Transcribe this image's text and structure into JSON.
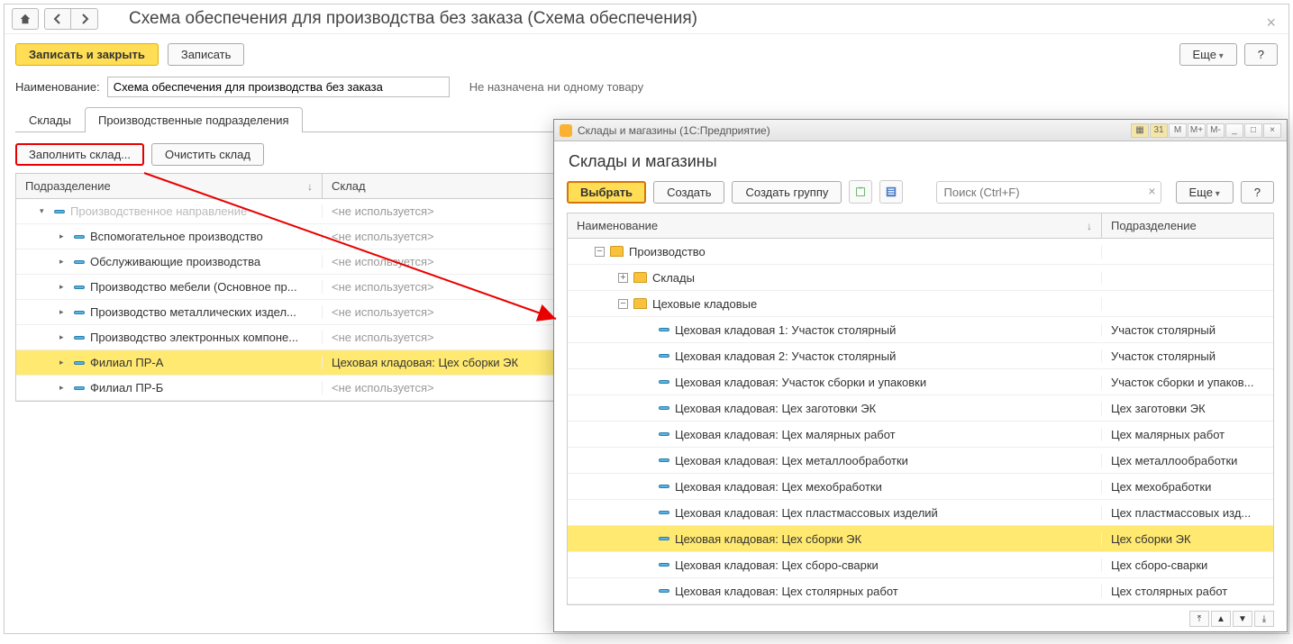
{
  "header": {
    "title": "Схема обеспечения для производства без заказа (Схема обеспечения)"
  },
  "toolbar": {
    "save_close": "Записать и закрыть",
    "save": "Записать",
    "more": "Еще",
    "help": "?"
  },
  "fields": {
    "name_label": "Наименование:",
    "name_value": "Схема обеспечения для производства без заказа",
    "status": "Не назначена ни одному товару"
  },
  "tabs": {
    "warehouses": "Склады",
    "departments": "Производственные подразделения"
  },
  "subtoolbar": {
    "fill": "Заполнить склад...",
    "clear": "Очистить склад"
  },
  "grid": {
    "col_dept": "Подразделение",
    "col_wh": "Склад",
    "not_used": "<не используется>",
    "rows": [
      {
        "indent": 0,
        "exp": "▾",
        "name": "Производственное направление",
        "wh": "<не используется>",
        "muted": true
      },
      {
        "indent": 1,
        "exp": "▸",
        "name": "Вспомогательное производство",
        "wh": "<не используется>",
        "muted": false
      },
      {
        "indent": 1,
        "exp": "▸",
        "name": "Обслуживающие производства",
        "wh": "<не используется>",
        "muted": false
      },
      {
        "indent": 1,
        "exp": "▸",
        "name": "Производство мебели (Основное пр...",
        "wh": "<не используется>",
        "muted": false
      },
      {
        "indent": 1,
        "exp": "▸",
        "name": "Производство металлических издел...",
        "wh": "<не используется>",
        "muted": false
      },
      {
        "indent": 1,
        "exp": "▸",
        "name": "Производство электронных компоне...",
        "wh": "<не используется>",
        "muted": false
      },
      {
        "indent": 1,
        "exp": "▸",
        "name": "Филиал ПР-А",
        "wh": "Цеховая кладовая: Цех сборки ЭК",
        "muted": false,
        "sel": true,
        "used": true
      },
      {
        "indent": 1,
        "exp": "▸",
        "name": "Филиал ПР-Б",
        "wh": "<не используется>",
        "muted": false
      }
    ]
  },
  "modal": {
    "window_caption": "Склады и магазины  (1С:Предприятие)",
    "title": "Склады и магазины",
    "select": "Выбрать",
    "create": "Создать",
    "create_group": "Создать группу",
    "search_placeholder": "Поиск (Ctrl+F)",
    "more": "Еще",
    "help": "?",
    "col_name": "Наименование",
    "col_dept": "Подразделение",
    "rows": [
      {
        "indent": 0,
        "pm": "−",
        "folder": true,
        "name": "Производство",
        "dept": ""
      },
      {
        "indent": 1,
        "pm": "+",
        "folder": true,
        "name": "Склады",
        "dept": ""
      },
      {
        "indent": 1,
        "pm": "−",
        "folder": true,
        "name": "Цеховые кладовые",
        "dept": ""
      },
      {
        "indent": 2,
        "pm": "",
        "folder": false,
        "name": "Цеховая кладовая 1: Участок столярный",
        "dept": "Участок столярный"
      },
      {
        "indent": 2,
        "pm": "",
        "folder": false,
        "name": "Цеховая кладовая 2: Участок столярный",
        "dept": "Участок столярный"
      },
      {
        "indent": 2,
        "pm": "",
        "folder": false,
        "name": "Цеховая кладовая: Участок сборки и упаковки",
        "dept": "Участок сборки и упаков..."
      },
      {
        "indent": 2,
        "pm": "",
        "folder": false,
        "name": "Цеховая кладовая: Цех заготовки ЭК",
        "dept": "Цех заготовки ЭК"
      },
      {
        "indent": 2,
        "pm": "",
        "folder": false,
        "name": "Цеховая кладовая: Цех малярных работ",
        "dept": "Цех малярных работ"
      },
      {
        "indent": 2,
        "pm": "",
        "folder": false,
        "name": "Цеховая кладовая: Цех металлообработки",
        "dept": "Цех металлообработки"
      },
      {
        "indent": 2,
        "pm": "",
        "folder": false,
        "name": "Цеховая кладовая: Цех мехобработки",
        "dept": "Цех мехобработки"
      },
      {
        "indent": 2,
        "pm": "",
        "folder": false,
        "name": "Цеховая кладовая: Цех пластмассовых изделий",
        "dept": "Цех пластмассовых изд..."
      },
      {
        "indent": 2,
        "pm": "",
        "folder": false,
        "name": "Цеховая кладовая: Цех сборки ЭК",
        "dept": "Цех сборки ЭК",
        "sel": true
      },
      {
        "indent": 2,
        "pm": "",
        "folder": false,
        "name": "Цеховая кладовая: Цех сборо-сварки",
        "dept": "Цех сборо-сварки"
      },
      {
        "indent": 2,
        "pm": "",
        "folder": false,
        "name": "Цеховая кладовая: Цех столярных работ",
        "dept": "Цех столярных работ"
      }
    ],
    "win_btns": {
      "m": "M",
      "mp": "M+",
      "mm": "M-",
      "min": "_",
      "max": "□",
      "close": "×"
    }
  }
}
